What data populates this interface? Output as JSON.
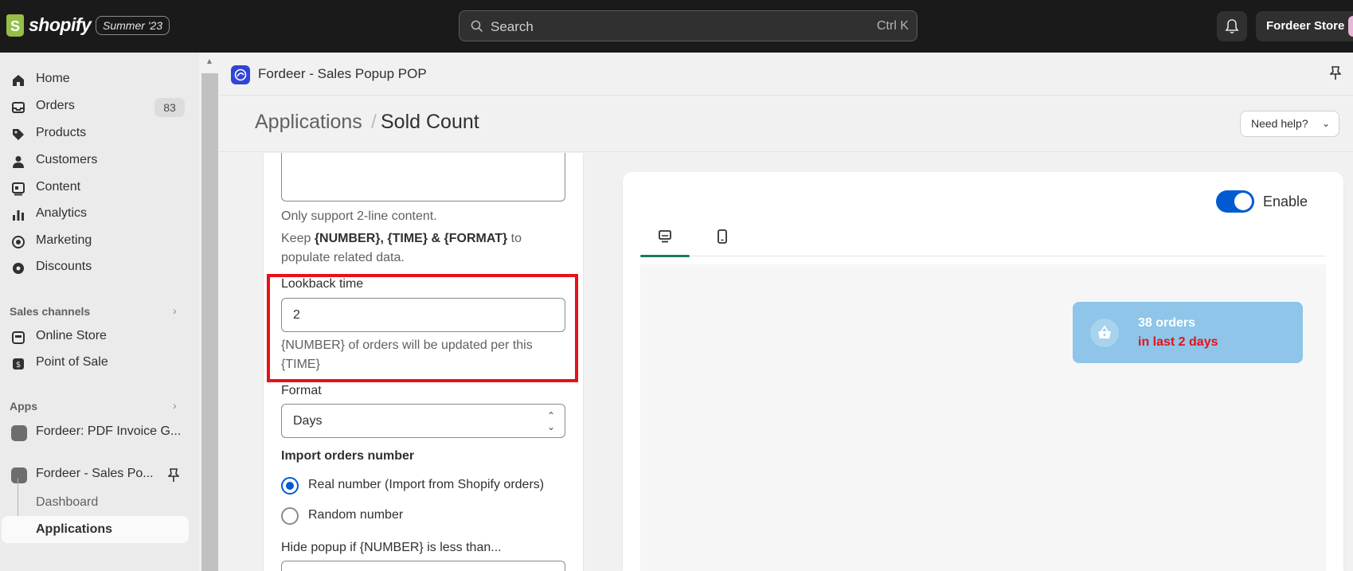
{
  "topbar": {
    "logo_letter": "S",
    "logo_text": "shopify",
    "edition_badge": "Summer '23",
    "search_placeholder": "Search",
    "search_shortcut": "Ctrl K",
    "store_name": "Fordeer Store"
  },
  "sidebar": {
    "items": [
      {
        "label": "Home",
        "icon": "home-icon"
      },
      {
        "label": "Orders",
        "icon": "inbox-icon",
        "count": "83"
      },
      {
        "label": "Products",
        "icon": "tag-icon"
      },
      {
        "label": "Customers",
        "icon": "person-icon"
      },
      {
        "label": "Content",
        "icon": "content-icon"
      },
      {
        "label": "Analytics",
        "icon": "bar-chart-icon"
      },
      {
        "label": "Marketing",
        "icon": "target-icon"
      },
      {
        "label": "Discounts",
        "icon": "gear-discount-icon"
      }
    ],
    "sales_channels_heading": "Sales channels",
    "sales_channels": [
      {
        "label": "Online Store",
        "icon": "store-icon"
      },
      {
        "label": "Point of Sale",
        "icon": "pos-icon"
      }
    ],
    "apps_heading": "Apps",
    "apps": [
      {
        "label": "Fordeer: PDF Invoice G...",
        "icon": "app-icon"
      },
      {
        "label": "Fordeer - Sales Po...",
        "icon": "app-icon"
      }
    ],
    "app_subitems": [
      "Dashboard",
      "Applications"
    ]
  },
  "app_header": {
    "title": "Fordeer - Sales Popup POP"
  },
  "page_header": {
    "breadcrumb": "Applications",
    "separator": "/",
    "title": "Sold Count",
    "help_label": "Need help?"
  },
  "settings": {
    "content_help_1": "Only support 2-line content.",
    "content_help_2_prefix": "Keep ",
    "content_help_2_bold": "{NUMBER}, {TIME} & {FORMAT}",
    "content_help_2_suffix": " to populate related data.",
    "lookback_label": "Lookback time",
    "lookback_value": "2",
    "lookback_help": "{NUMBER} of orders will be updated per this {TIME}",
    "format_label": "Format",
    "format_value": "Days",
    "import_label": "Import orders number",
    "import_options": [
      {
        "label": "Real number (Import from Shopify orders)",
        "selected": true
      },
      {
        "label": "Random number",
        "selected": false
      }
    ],
    "hide_label": "Hide popup if {NUMBER} is less than..."
  },
  "preview": {
    "enable_label": "Enable",
    "enabled": true,
    "tabs": [
      {
        "icon": "desktop-icon",
        "active": true
      },
      {
        "icon": "mobile-icon",
        "active": false
      }
    ],
    "popup_line1": "38 orders",
    "popup_line2": "in last 2 days",
    "popup_bg": "#8ec5e8",
    "popup_accent": "#e8101a"
  },
  "colors": {
    "topbar": "#1a1a1a",
    "primary": "#005bd3",
    "highlight": "#e8101a",
    "tab_active": "#1a7b52"
  }
}
